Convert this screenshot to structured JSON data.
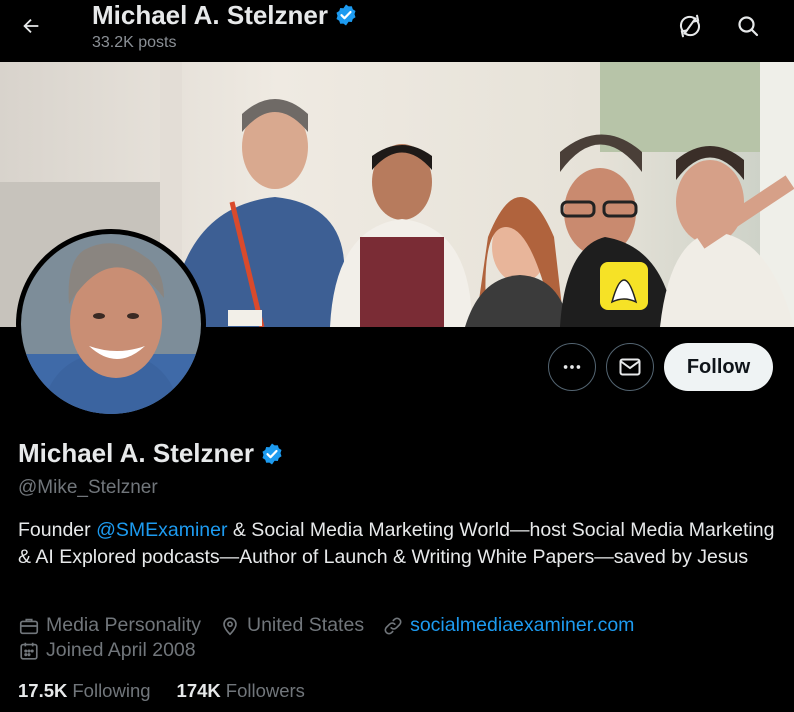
{
  "header": {
    "title": "Michael A. Stelzner",
    "posts_count": "33.2K posts"
  },
  "profile": {
    "name": "Michael A. Stelzner",
    "handle": "@Mike_Stelzner",
    "verified": true,
    "follow_label": "Follow",
    "bio": {
      "part1": "Founder ",
      "mention": "@SMExaminer",
      "part2": " & Social Media Marketing World—host Social Media Marketing & AI Explored podcasts—Author of Launch & Writing White Papers—saved by Jesus"
    },
    "meta": {
      "category": "Media Personality",
      "location": "United States",
      "website": "socialmediaexaminer.com",
      "joined": "Joined April 2008"
    },
    "stats": {
      "following_count": "17.5K",
      "following_label": "Following",
      "followers_count": "174K",
      "followers_label": "Followers"
    }
  },
  "icons": {
    "back": "arrow-left-icon",
    "refresh": "refresh-icon",
    "search": "search-icon",
    "more": "more-icon",
    "message": "envelope-icon",
    "verified": "verified-badge-icon",
    "category": "briefcase-icon",
    "location": "location-pin-icon",
    "website": "link-icon",
    "joined": "calendar-icon"
  },
  "colors": {
    "background": "#000000",
    "text": "#e7e9ea",
    "secondary_text": "#71767b",
    "accent": "#1d9bf0",
    "follow_button_bg": "#eff3f4"
  }
}
